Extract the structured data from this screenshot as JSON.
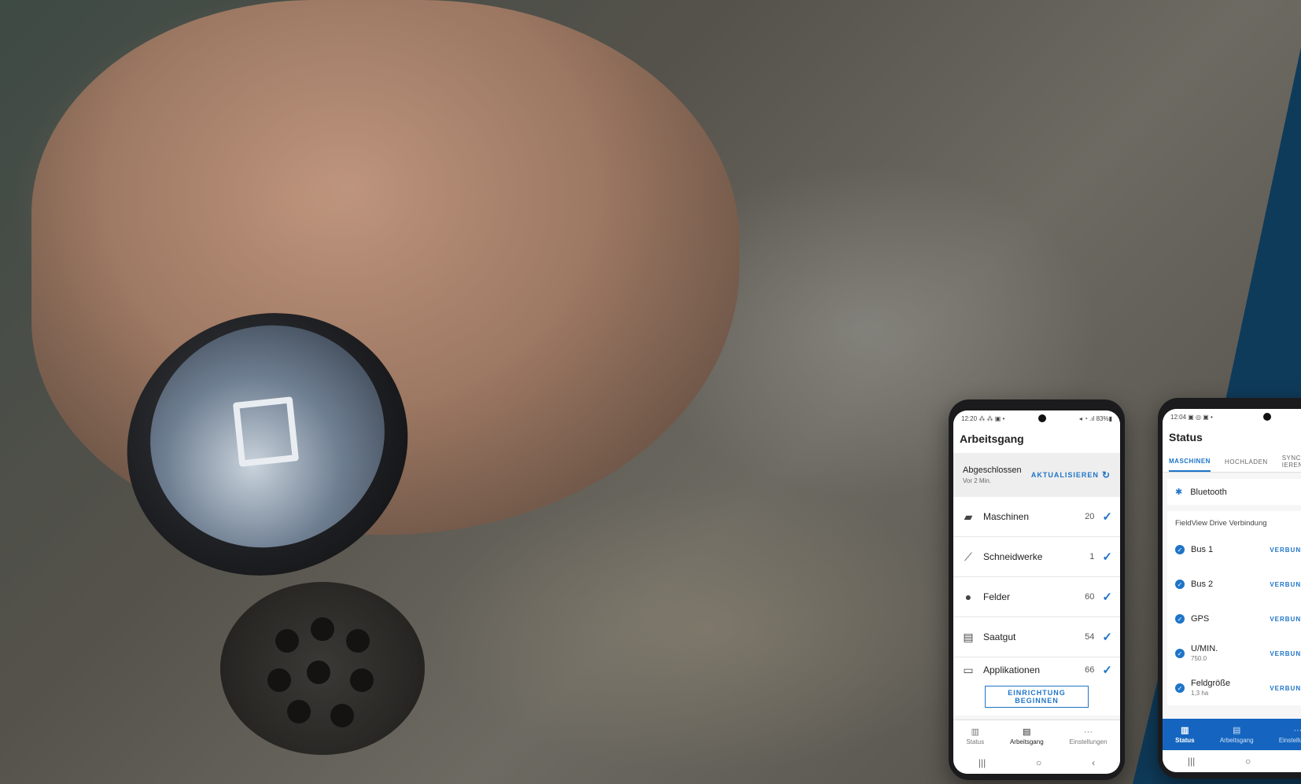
{
  "phone1": {
    "statusbar": {
      "time": "12:20",
      "icons": "⁂ ⁂ ▣ •",
      "right": "◂ ◔ .ıl 83%▮"
    },
    "title": "Arbeitsgang",
    "sync": {
      "status": "Abgeschlossen",
      "time": "Vor 2 Min.",
      "refresh_label": "AKTUALISIEREN"
    },
    "rows": [
      {
        "icon": "tractor-icon",
        "glyph": "🚜",
        "label": "Maschinen",
        "count": "20"
      },
      {
        "icon": "header-icon",
        "glyph": "⟋",
        "label": "Schneidwerke",
        "count": "1"
      },
      {
        "icon": "location-pin-icon",
        "glyph": "⬤",
        "label": "Felder",
        "count": "60"
      },
      {
        "icon": "seed-bag-icon",
        "glyph": "▤",
        "label": "Saatgut",
        "count": "54"
      },
      {
        "icon": "folder-icon",
        "glyph": "▭",
        "label": "Applikationen",
        "count": "66"
      }
    ],
    "setup_button": "EINRICHTUNG BEGINNEN",
    "nav": [
      {
        "label": "Status",
        "glyph": "▥"
      },
      {
        "label": "Arbeitsgang",
        "glyph": "▤"
      },
      {
        "label": "Einstellungen",
        "glyph": "···"
      }
    ]
  },
  "phone2": {
    "statusbar": {
      "time": "12:04",
      "icons": "▣ ◎ ▣ •"
    },
    "title": "Status",
    "tabs": [
      "MASCHINEN",
      "HOCHLADEN",
      "SYNCHRONIS-IEREN"
    ],
    "bluetooth": "Bluetooth",
    "section_title": "FieldView Drive Verbindung",
    "rows": [
      {
        "label": "Bus 1",
        "sub": "",
        "state": "VERBUNDEN"
      },
      {
        "label": "Bus 2",
        "sub": "",
        "state": "VERBUNDEN"
      },
      {
        "label": "GPS",
        "sub": "",
        "state": "VERBUNDEN"
      },
      {
        "label": "U/MIN.",
        "sub": "750.0",
        "state": "VERBUNDEN"
      },
      {
        "label": "Feldgröße",
        "sub": "1,3 ha",
        "state": "VERBUNDEN"
      }
    ],
    "nav": [
      {
        "label": "Status",
        "glyph": "▥"
      },
      {
        "label": "Arbeitsgang",
        "glyph": "▤"
      },
      {
        "label": "Einstellungen",
        "glyph": "···"
      }
    ]
  },
  "colors": {
    "accent": "#1e74c8",
    "panel": "#0f3b5a"
  }
}
